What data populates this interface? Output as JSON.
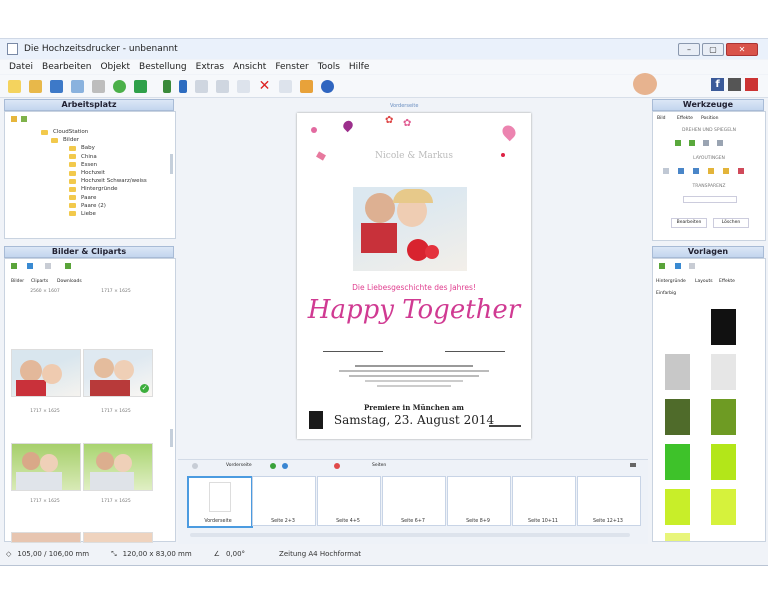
{
  "window": {
    "title": "Die Hochzeitsdrucker - unbenannt",
    "min": "–",
    "max": "▢",
    "close": "✕"
  },
  "menu": [
    "Datei",
    "Bearbeiten",
    "Objekt",
    "Bestellung",
    "Extras",
    "Ansicht",
    "Fenster",
    "Tools",
    "Hilfe"
  ],
  "brand": {
    "fb": "f"
  },
  "panels": {
    "workspace": "Arbeitsplatz",
    "images": "Bilder & Cliparts",
    "tools": "Werkzeuge",
    "templates": "Vorlagen"
  },
  "tree": {
    "root": "CloudStation",
    "folder": "Bilder",
    "items": [
      "Baby",
      "China",
      "Essen",
      "Hochzeit",
      "Hochzeit Schwarz/weiss",
      "Hintergründe",
      "Paare",
      "Paare (2)",
      "Liebe"
    ]
  },
  "images_tabs": [
    "Bilder",
    "Cliparts",
    "Downloads"
  ],
  "image_captions": [
    "2560 × 1607",
    "1717 × 1625",
    "1717 × 1625",
    "1717 × 1625",
    "1717 × 1625",
    "1717 × 1625"
  ],
  "tools_panel": {
    "tabs": [
      "Bild",
      "Effekte",
      "Position"
    ],
    "section1": "DREHEN UND SPIEGELN",
    "section2": "LAYOUTINGEN",
    "section3": "TRANSPARENZ",
    "buttons": [
      "Bearbeiten",
      "Löschen"
    ]
  },
  "templates_panel": {
    "tabs": [
      "Hintergründe",
      "Layouts",
      "Effekte"
    ],
    "dropdown": "Einfarbig",
    "colors": [
      "#111111",
      "#c8c8c8",
      "#e6e6e6",
      "#4f6b2a",
      "#6e9b23",
      "#3ec22a",
      "#b3e619",
      "#c8ee29",
      "#d6f23c",
      "#e8f57a"
    ]
  },
  "page_label": "Vorderseite",
  "card": {
    "names": "Nicole & Markus",
    "subtitle": "Die Liebesgeschichte des Jahres!",
    "headline": "Happy Together",
    "city_line": "Premiere in München am",
    "date": "Samstag, 23. August 2014"
  },
  "strip": {
    "toolbar_label": "Vorderseite",
    "pages_label": "Seiten",
    "pages": [
      "Vorderseite",
      "Seite 2+3",
      "Seite 4+5",
      "Seite 6+7",
      "Seite 8+9",
      "Seite 10+11",
      "Seite 12+13"
    ]
  },
  "status": {
    "position": "105,00 / 106,00 mm",
    "size": "120,00 x 83,00 mm",
    "angle": "0,00°",
    "format": "Zeitung A4 Hochformat"
  }
}
